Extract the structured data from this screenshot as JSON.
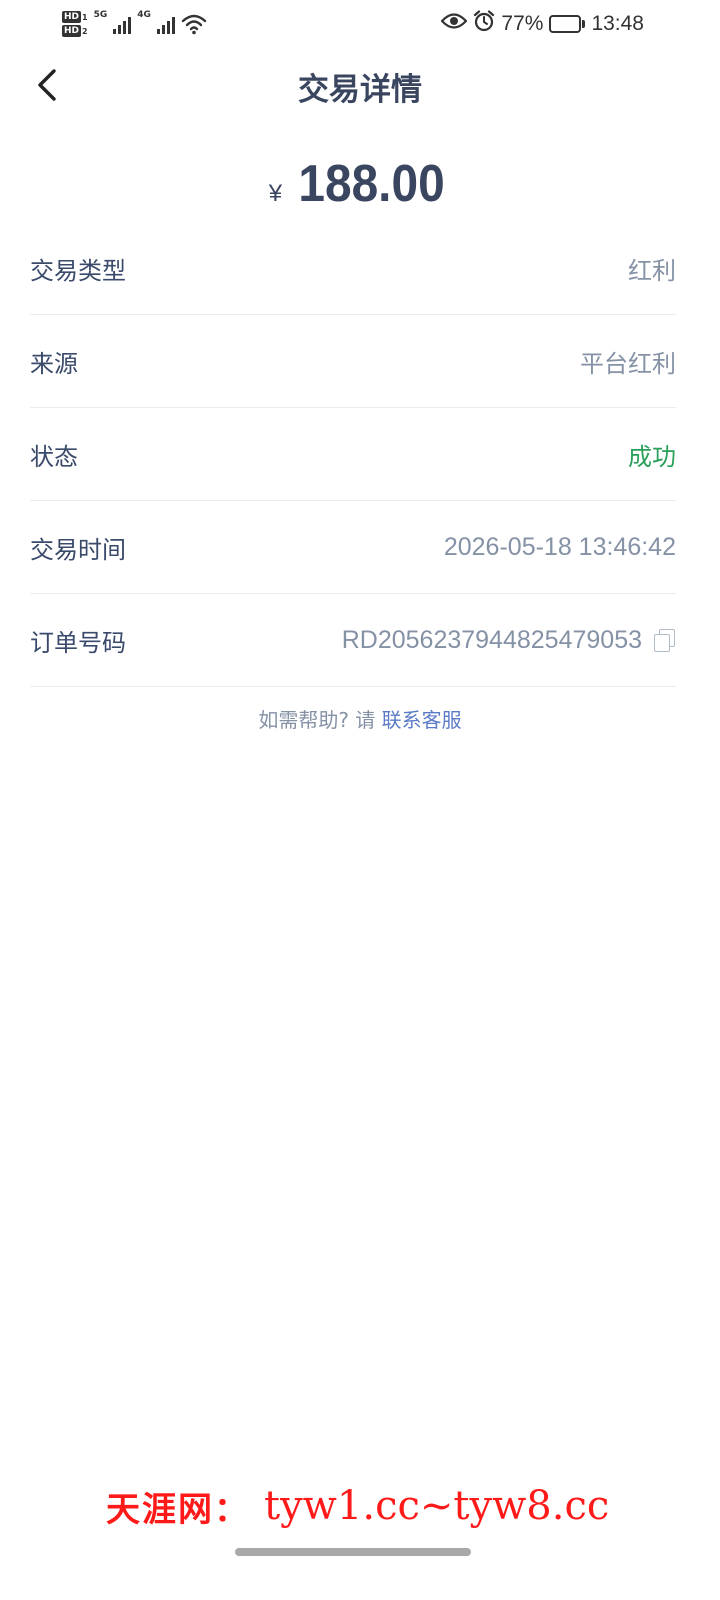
{
  "status_bar": {
    "sim1_badge": "HD",
    "sim1_index": "1",
    "sim2_badge": "HD",
    "sim2_index": "2",
    "network1": "5G",
    "network2": "4G",
    "battery_percent": "77%",
    "battery_level": 0.77,
    "time": "13:48",
    "icons": [
      "eye-icon",
      "alarm-icon",
      "wifi-icon",
      "signal-icon",
      "battery-icon"
    ]
  },
  "header": {
    "title": "交易详情",
    "back_icon": "chevron-left-icon"
  },
  "amount": {
    "currency": "¥",
    "value": "188.00"
  },
  "details": [
    {
      "label": "交易类型",
      "value": "红利"
    },
    {
      "label": "来源",
      "value": "平台红利"
    },
    {
      "label": "状态",
      "value": "成功"
    },
    {
      "label": "交易时间",
      "value": "2026-05-18 13:46:42"
    },
    {
      "label": "订单号码",
      "value": "RD2056237944825479053"
    }
  ],
  "help": {
    "prefix": "如需帮助? 请",
    "link": "联系客服"
  },
  "watermark": {
    "text_cn": "天涯网：",
    "text_url": "tyw1.cc~tyw8.cc"
  },
  "colors": {
    "title": "#3a4560",
    "label": "#3a4a6b",
    "value": "#8592a6",
    "success": "#2aa05a",
    "link": "#5b7bc8",
    "watermark": "#ff1a1a"
  }
}
